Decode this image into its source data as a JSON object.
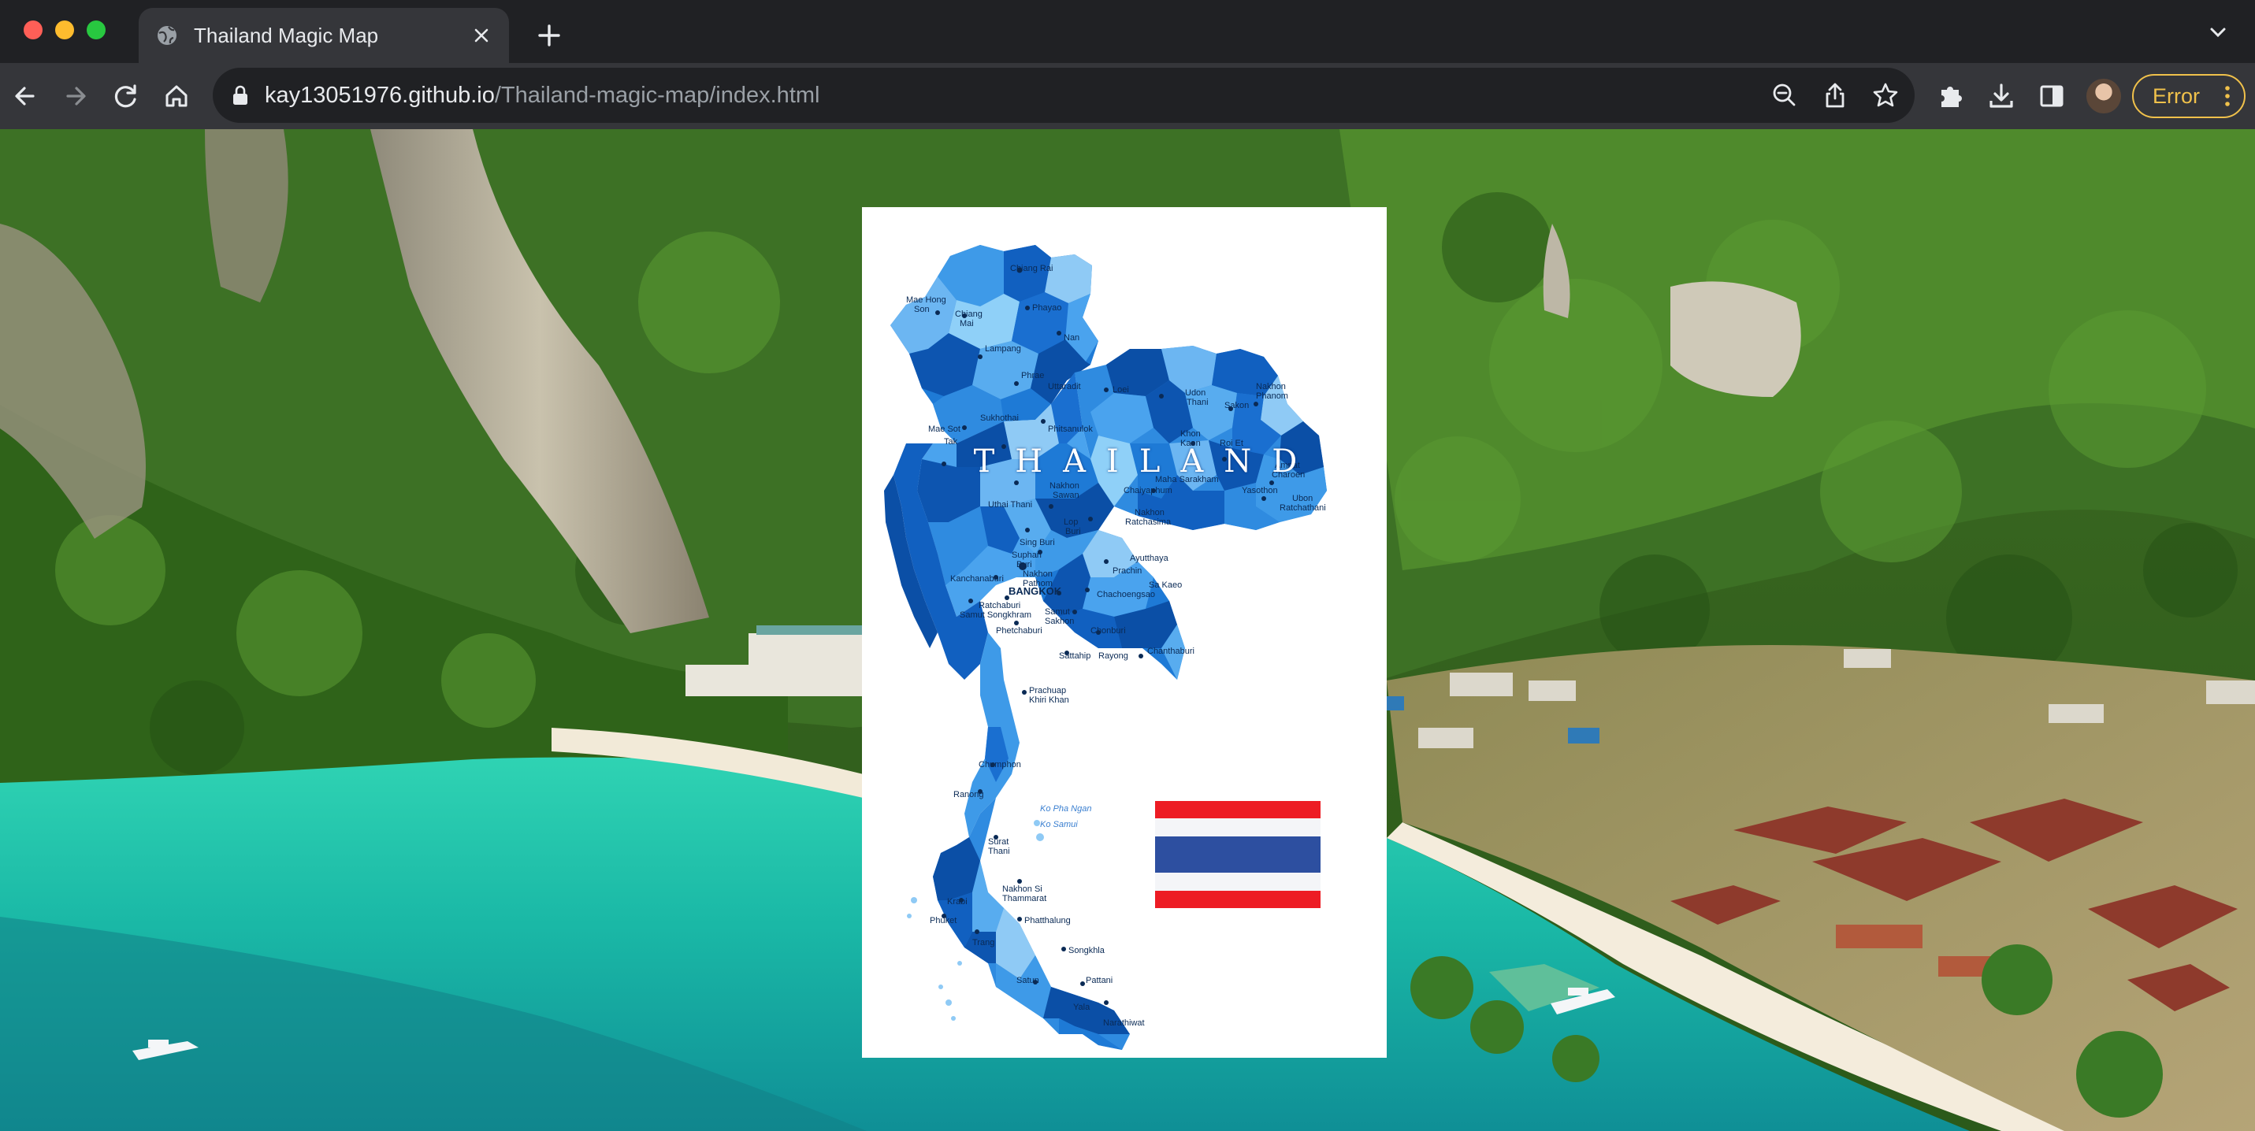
{
  "browser": {
    "tab_title": "Thailand Magic Map",
    "url_host": "kay13051976.github.io",
    "url_path": "/Thailand-magic-map/index.html",
    "profile_button_label": "Error",
    "accent_color": "#f0c14b"
  },
  "page": {
    "map_title": "THAILAND",
    "flag_colors": [
      "#ed1c24",
      "#f4f5f8",
      "#2d4fa0",
      "#f4f5f8",
      "#ed1c24"
    ],
    "map_labels": [
      {
        "text": "Chiang Rai"
      },
      {
        "text": "Mae Hong"
      },
      {
        "text": "Son"
      },
      {
        "text": "Chiang"
      },
      {
        "text": "Mai"
      },
      {
        "text": "Phayao"
      },
      {
        "text": "Nan"
      },
      {
        "text": "Lampang"
      },
      {
        "text": "Phrae"
      },
      {
        "text": "Uttaradit"
      },
      {
        "text": "Loei"
      },
      {
        "text": "Udon"
      },
      {
        "text": "Thani"
      },
      {
        "text": "Sakon"
      },
      {
        "text": "Nakhon"
      },
      {
        "text": "Phanom"
      },
      {
        "text": "Sukhothai"
      },
      {
        "text": "Phitsanulok"
      },
      {
        "text": "Tak"
      },
      {
        "text": "Mae Sot"
      },
      {
        "text": "Khon"
      },
      {
        "text": "Kaen"
      },
      {
        "text": "Roi Et"
      },
      {
        "text": "Amnat"
      },
      {
        "text": "Charoen"
      },
      {
        "text": "Yasothon"
      },
      {
        "text": "Ubon"
      },
      {
        "text": "Ratchathani"
      },
      {
        "text": "Nakhon"
      },
      {
        "text": "Sawan"
      },
      {
        "text": "Uthai Thani"
      },
      {
        "text": "Chaiyaphum"
      },
      {
        "text": "Maha Sarakham"
      },
      {
        "text": "Lop"
      },
      {
        "text": "Buri"
      },
      {
        "text": "Nakhon"
      },
      {
        "text": "Ratchasima"
      },
      {
        "text": "Sing Buri"
      },
      {
        "text": "Suphan"
      },
      {
        "text": "Buri"
      },
      {
        "text": "Kanchanaburi"
      },
      {
        "text": "BANGKOK"
      },
      {
        "text": "Nakhon"
      },
      {
        "text": "Pathom"
      },
      {
        "text": "Ratchaburi"
      },
      {
        "text": "Samut Songkhram"
      },
      {
        "text": "Samut"
      },
      {
        "text": "Sakhon"
      },
      {
        "text": "Ayutthaya"
      },
      {
        "text": "Sa Kaeo"
      },
      {
        "text": "Chachoengsao"
      },
      {
        "text": "Prachin"
      },
      {
        "text": "Phetchaburi"
      },
      {
        "text": "Chonburi"
      },
      {
        "text": "Rayong"
      },
      {
        "text": "Sattahip"
      },
      {
        "text": "Chanthaburi"
      },
      {
        "text": "Prachuap"
      },
      {
        "text": "Khiri Khan"
      },
      {
        "text": "Chumphon"
      },
      {
        "text": "Ranong"
      },
      {
        "text": "Ko Pha Ngan"
      },
      {
        "text": "Ko Samui"
      },
      {
        "text": "Surat"
      },
      {
        "text": "Thani"
      },
      {
        "text": "Krabi"
      },
      {
        "text": "Phuket"
      },
      {
        "text": "Nakhon Si"
      },
      {
        "text": "Thammarat"
      },
      {
        "text": "Phatthalung"
      },
      {
        "text": "Trang"
      },
      {
        "text": "Songkhla"
      },
      {
        "text": "Satun"
      },
      {
        "text": "Yala"
      },
      {
        "text": "Pattani"
      },
      {
        "text": "Narathiwat"
      }
    ]
  }
}
